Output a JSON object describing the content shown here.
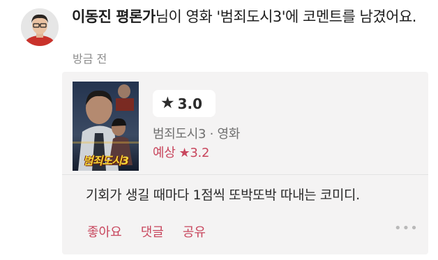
{
  "post": {
    "author": "이동진 평론가",
    "headline_rest": "님이 영화 '범죄도시3'에 코멘트를 남겼어요.",
    "time": "방금 전"
  },
  "card": {
    "poster_title": "범죄도시3",
    "rating_star": "★",
    "rating_value": "3.0",
    "movie_meta": "범죄도시3 · 영화",
    "expected_label": "예상",
    "expected_value": "★3.2",
    "comment": "기회가 생길 때마다 1점씩 또박또박 따내는 코미디."
  },
  "actions": {
    "like": "좋아요",
    "reply": "댓글",
    "share": "공유",
    "more": "•••"
  },
  "colors": {
    "accent": "#c8465d",
    "card_bg": "#f4f3f3",
    "muted": "#8c8c8c"
  },
  "icons": {
    "avatar": "user-avatar",
    "star": "star-icon",
    "more": "more-options-icon"
  }
}
